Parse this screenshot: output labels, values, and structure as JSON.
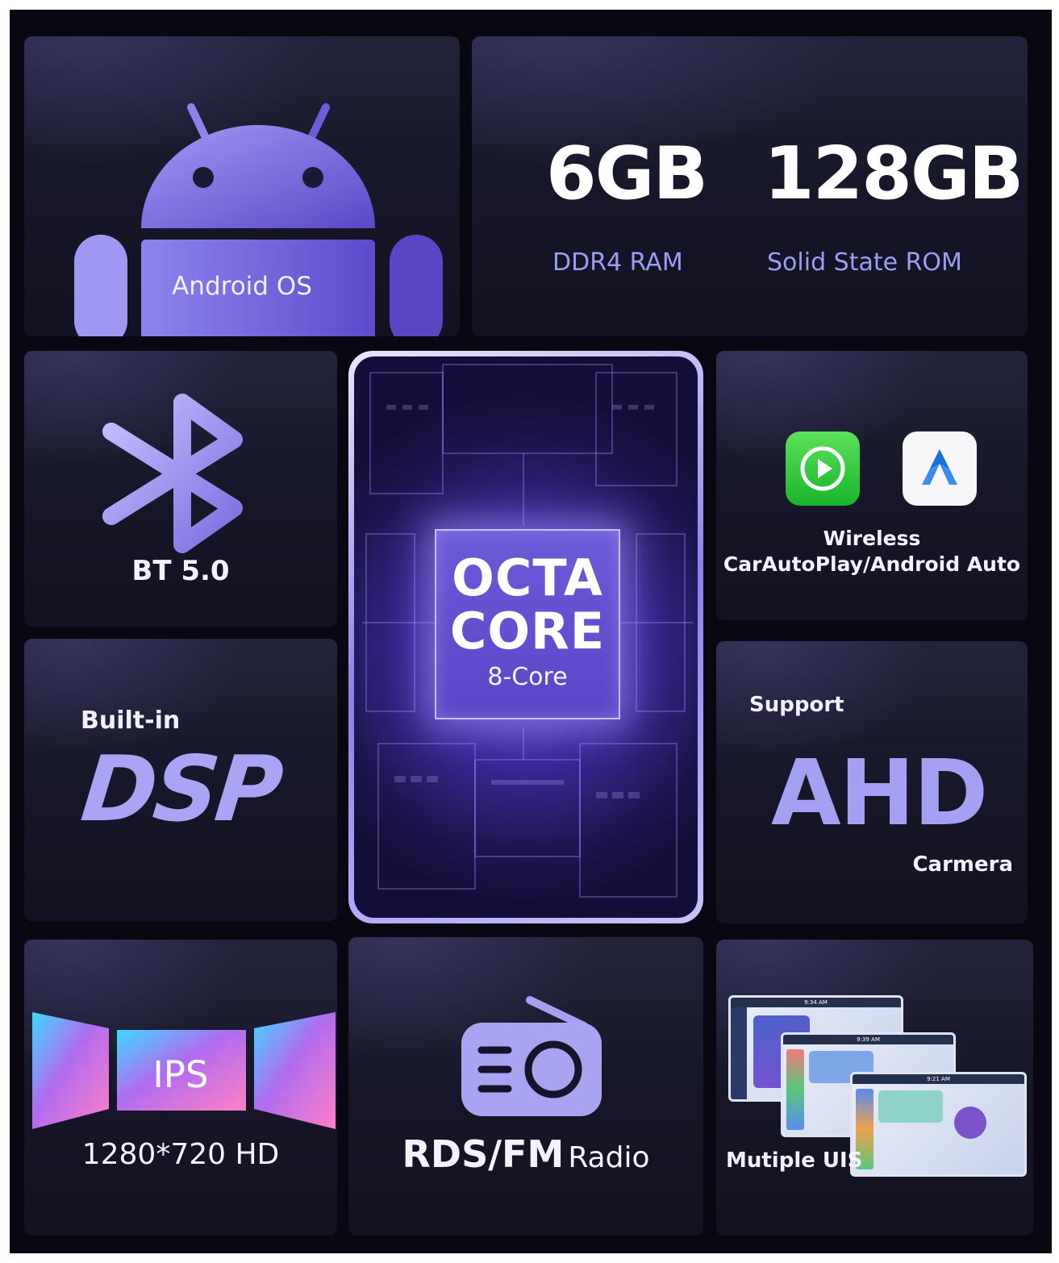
{
  "android": {
    "label": "Android OS"
  },
  "memory": {
    "ram_size": "6GB",
    "ram_type": "DDR4 RAM",
    "rom_size": "128GB",
    "rom_type": "Solid State ROM"
  },
  "bluetooth": {
    "label": "BT 5.0"
  },
  "cpu": {
    "line1": "OCTA",
    "line2": "CORE",
    "line3": "8-Core"
  },
  "carplay": {
    "line1": "Wireless",
    "line2": "CarAutoPlay/Android Auto"
  },
  "dsp": {
    "prefix": "Built-in",
    "label": "DSP"
  },
  "ahd": {
    "prefix": "Support",
    "label": "AHD",
    "suffix": "Carmera"
  },
  "display": {
    "panel": "IPS",
    "resolution": "1280*720 HD"
  },
  "radio": {
    "bold": "RDS/FM",
    "regular": "Radio"
  },
  "uis": {
    "label": "Mutiple UIS",
    "screen_times": [
      "9:34 AM",
      "9:39 AM",
      "9:21 AM"
    ]
  },
  "colors": {
    "accent": "#8f86ee",
    "background": "#090812",
    "tile": "#1a1a2e"
  }
}
